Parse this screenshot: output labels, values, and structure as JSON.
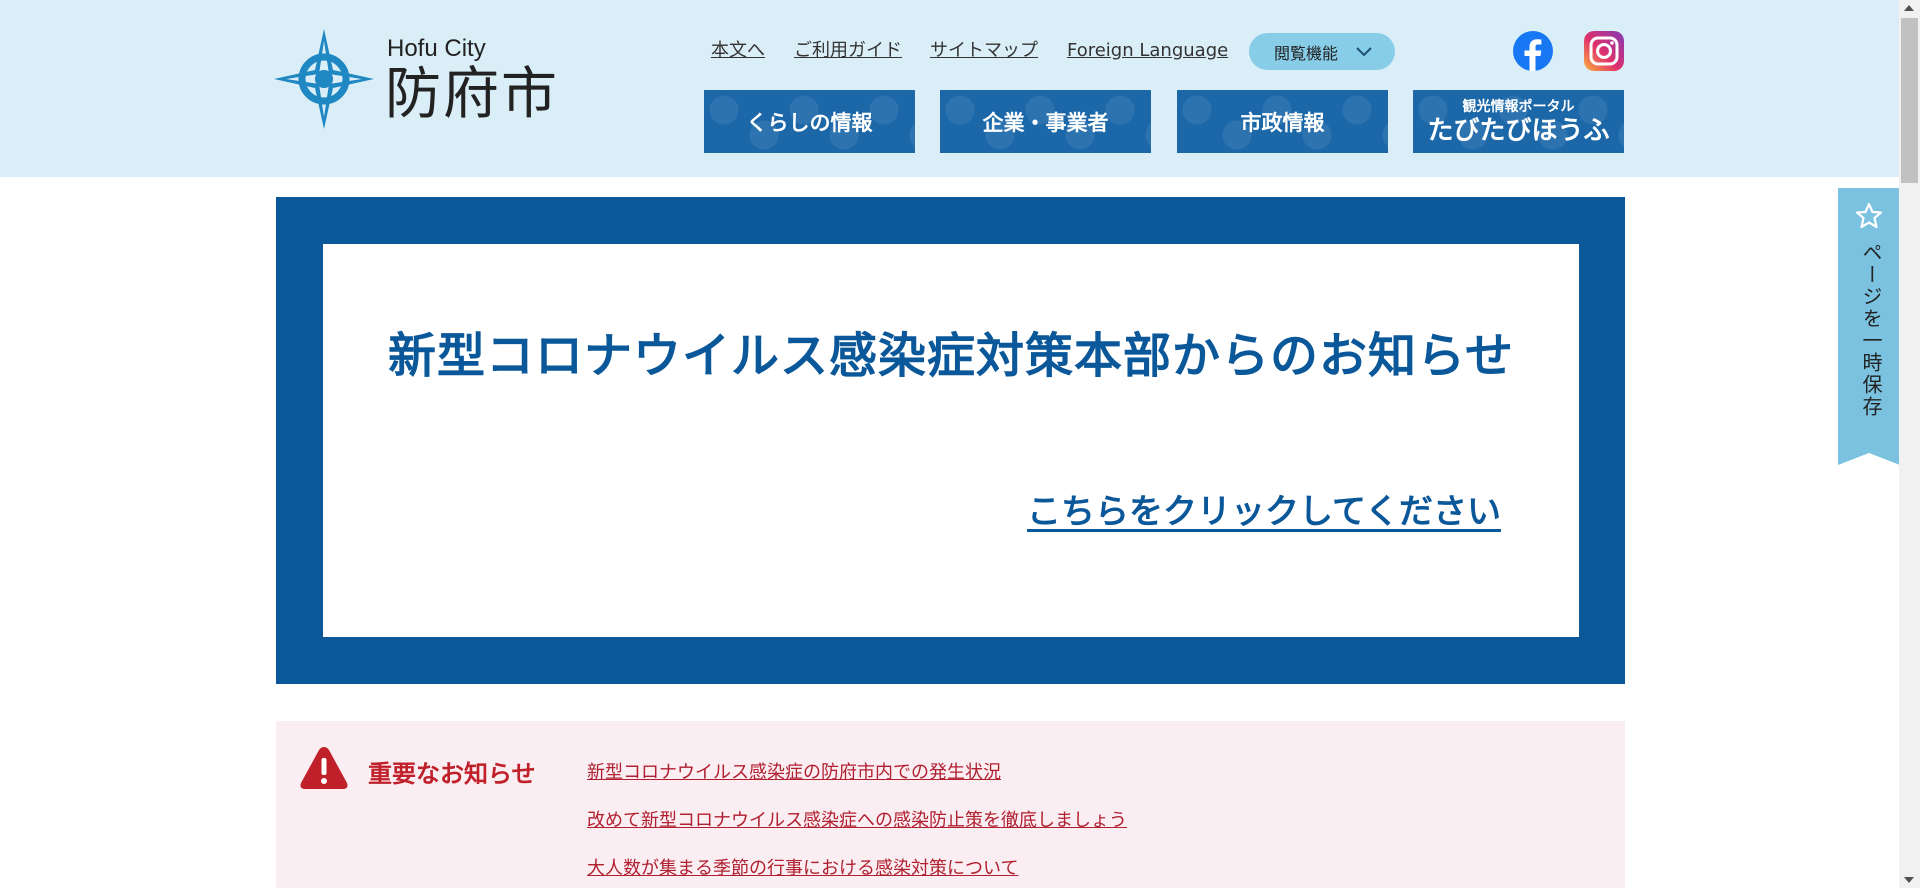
{
  "header": {
    "logo_en": "Hofu City",
    "logo_ja": "防府市",
    "util_links": [
      "本文へ",
      "ご利用ガイド",
      "サイトマップ",
      "Foreign Language"
    ],
    "browse_label": "閲覧機能",
    "nav": [
      "くらしの情報",
      "企業・事業者",
      "市政情報"
    ],
    "portal_small": "観光情報ポータル",
    "portal_large": "たびたびほうふ"
  },
  "banner": {
    "title": "新型コロナウイルス感染症対策本部からのお知らせ",
    "link": "こちらをクリックしてください"
  },
  "notice": {
    "title": "重要なお知らせ",
    "links": [
      "新型コロナウイルス感染症の防府市内での発生状況",
      "改めて新型コロナウイルス感染症への感染防止策を徹底しましょう",
      "大人数が集まる季節の行事における感染対策について"
    ]
  },
  "save_tab": {
    "label": "ページを一時保存"
  },
  "colors": {
    "header_bg": "#daeef7",
    "nav_bg": "#1b67a8",
    "banner_blue": "#0a5799",
    "notice_bg": "#fbeef2",
    "notice_red": "#c0202a",
    "save_tab_bg": "#7ac2e0"
  },
  "icons": [
    "city-emblem-icon",
    "chevron-down-icon",
    "facebook-icon",
    "instagram-icon",
    "warning-icon",
    "star-icon"
  ]
}
